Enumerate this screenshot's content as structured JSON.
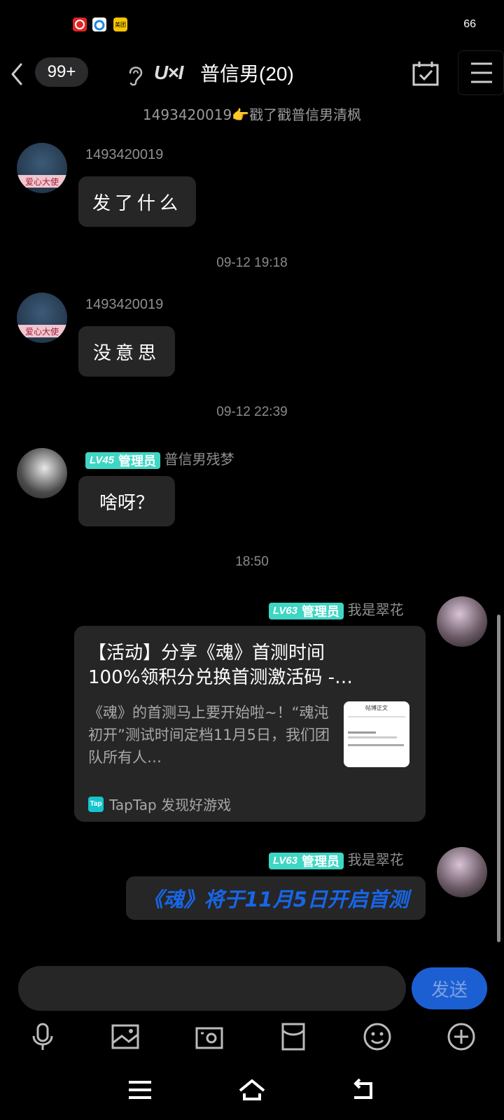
{
  "status_bar": {
    "battery": "66",
    "app_icons": [
      {
        "name": "netease-music-icon",
        "color": "#e02424"
      },
      {
        "name": "qq-browser-icon",
        "color": "#ffffff"
      },
      {
        "name": "meituan-icon",
        "color": "#f7c500",
        "label": "美团"
      }
    ]
  },
  "header": {
    "unread_badge": "99+",
    "logo_text": "U×I",
    "title": "普信男(20)"
  },
  "system_message": "1493420019👉戳了戳普信男清枫",
  "messages": [
    {
      "type": "timestamp",
      "text": ""
    },
    {
      "sender": "1493420019",
      "text": "发了什么"
    },
    {
      "type": "timestamp",
      "text": "09-12 19:18"
    },
    {
      "sender": "1493420019",
      "text": "没意思"
    },
    {
      "type": "timestamp",
      "text": "09-12 22:39"
    },
    {
      "sender": "普信男残梦",
      "level": "LV45",
      "role": "管理员",
      "text": "啥呀？"
    },
    {
      "type": "timestamp",
      "text": "18:50"
    },
    {
      "sender": "我是翠花",
      "level": "LV63",
      "role": "管理员",
      "card": {
        "title": "【活动】分享《魂》首测时间\n100%领积分兑换首测激活码 -…",
        "description": "《魂》的首测马上要开始啦~！“魂沌初开”测试时间定档11月5日，我们团队所有人…",
        "source": "TapTap 发现好游戏",
        "source_icon_text": "Tap",
        "thumb_title": "帖博正文"
      }
    },
    {
      "sender": "我是翠花",
      "level": "LV63",
      "role": "管理员",
      "text": "《魂》将于11月5日开启首测"
    }
  ],
  "input": {
    "placeholder": "",
    "value": ""
  },
  "send_label": "发送",
  "avatar_badge_text": "爱心大使",
  "colors": {
    "accent": "#1c5fd2",
    "level_badge": "#3fd6c4",
    "bubble": "#262626",
    "highlight_text": "#1766e8"
  },
  "toolbar": [
    "microphone-icon",
    "image-icon",
    "camera-icon",
    "red-envelope-icon",
    "emoji-icon",
    "plus-icon"
  ],
  "nav": [
    "menu-icon",
    "home-icon",
    "back-icon"
  ]
}
